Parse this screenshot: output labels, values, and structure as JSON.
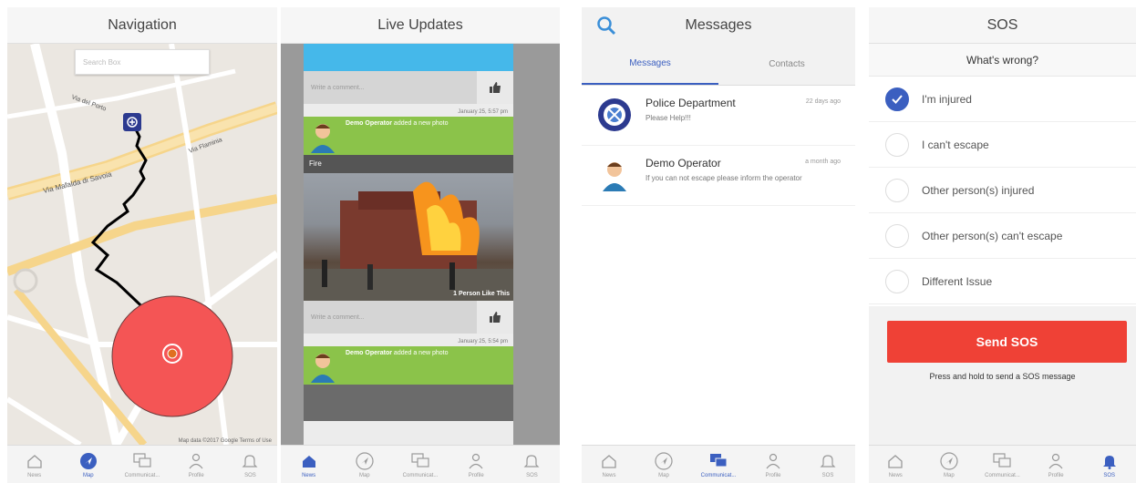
{
  "tabs": [
    {
      "label": "News",
      "icon": "home-icon"
    },
    {
      "label": "Map",
      "icon": "navigation-icon"
    },
    {
      "label": "Communicat...",
      "icon": "chat-icon"
    },
    {
      "label": "Profile",
      "icon": "person-icon"
    },
    {
      "label": "SOS",
      "icon": "bell-icon"
    }
  ],
  "nav": {
    "title": "Navigation",
    "search_placeholder": "Search Box",
    "map_footer": "Map data ©2017 Google   Terms of Use",
    "streets": [
      "Via Mafalda di Savoia",
      "Via Flaminia",
      "Via del Porto"
    ]
  },
  "live": {
    "title": "Live Updates",
    "comment_placeholder": "Write a comment...",
    "posts": [
      {
        "time": "January 25, 5:57 pm",
        "author": "Demo Operator",
        "action": "added a new photo",
        "photo_title": "Fire",
        "photo_caption": "1 Person Like This"
      },
      {
        "time": "January 25, 5:54 pm",
        "author": "Demo Operator",
        "action": "added a new photo"
      }
    ]
  },
  "messages": {
    "title": "Messages",
    "tab_messages": "Messages",
    "tab_contacts": "Contacts",
    "items": [
      {
        "name": "Police Department",
        "preview": "Please Help!!!",
        "time": "22 days ago"
      },
      {
        "name": "Demo Operator",
        "preview": "If you can not escape please inform the operator",
        "time": "a month ago"
      }
    ]
  },
  "sos": {
    "title": "SOS",
    "question": "What's wrong?",
    "options": [
      "I'm injured",
      "I can't escape",
      "Other person(s) injured",
      "Other person(s) can't escape",
      "Different Issue"
    ],
    "selected_index": 0,
    "button": "Send SOS",
    "hint": "Press and hold to send a SOS message"
  },
  "colors": {
    "accent": "#3b5fc0",
    "sos_red": "#ef4136",
    "green": "#8bc34a",
    "blue_bar": "#45b8ea"
  }
}
